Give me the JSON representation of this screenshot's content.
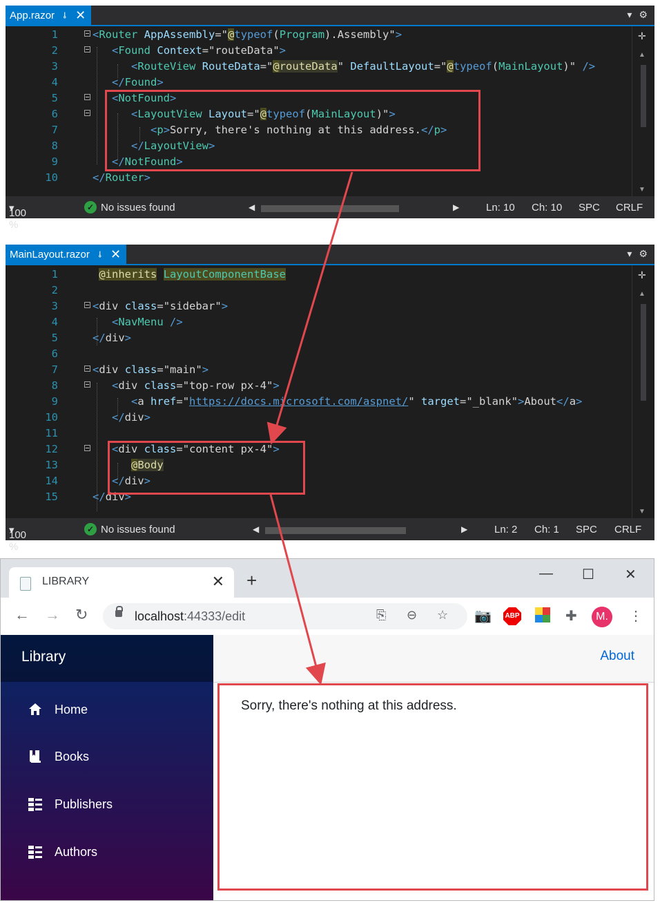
{
  "panel1": {
    "tab_title": "App.razor",
    "lines": [
      "1",
      "2",
      "3",
      "4",
      "5",
      "6",
      "7",
      "8",
      "9",
      "10"
    ],
    "zoom": "100 %",
    "issues": "No issues found",
    "ln": "Ln: 10",
    "ch": "Ch: 10",
    "spc": "SPC",
    "crlf": "CRLF"
  },
  "panel2": {
    "tab_title": "MainLayout.razor",
    "lines": [
      "1",
      "2",
      "3",
      "4",
      "5",
      "6",
      "7",
      "8",
      "9",
      "10",
      "11",
      "12",
      "13",
      "14",
      "15"
    ],
    "zoom": "100 %",
    "issues": "No issues found",
    "ln": "Ln: 2",
    "ch": "Ch: 1",
    "spc": "SPC",
    "crlf": "CRLF"
  },
  "browser": {
    "tab_title": "LIBRARY",
    "url_host": "localhost",
    "url_rest": ":44333/edit",
    "avatar": "M.",
    "sidebar_brand": "Library",
    "nav": [
      "Home",
      "Books",
      "Publishers",
      "Authors"
    ],
    "about": "About",
    "message": "Sorry, there's nothing at this address."
  },
  "colors": {
    "accent": "#007acc",
    "highlight_box": "#e0484d",
    "sidebar_top": "#052767",
    "sidebar_bottom": "#3a0647",
    "link": "#0366d6"
  }
}
